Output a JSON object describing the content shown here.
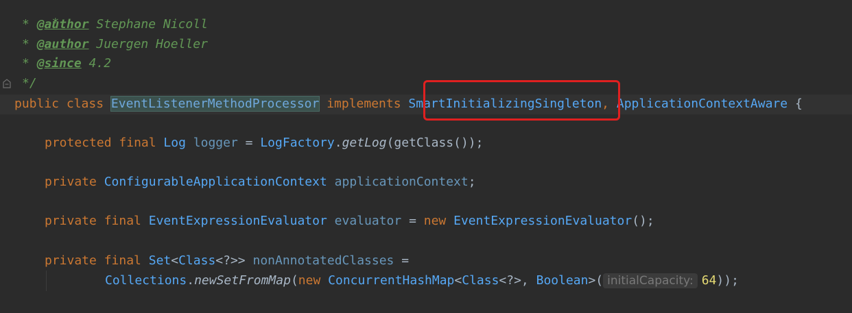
{
  "code": {
    "doc_lines": {
      "star": "*",
      "author1_tag": "@author",
      "author1_name": " Stephane Nicoll",
      "author2_tag": "@author",
      "author2_name": " Juergen Hoeller",
      "since_tag": "@since",
      "since_value": " 4.2",
      "close": "*/"
    },
    "class_decl": {
      "public": "public",
      "class": "class",
      "name": "EventListenerMethodProcessor",
      "implements": "implements",
      "iface1": "SmartInitializingSingleton",
      "comma": ",",
      "iface2": "ApplicationContextAware",
      "brace": "{"
    },
    "logger_line": {
      "protected": "protected",
      "final": "final",
      "type": "Log",
      "field": "logger",
      "eq": "=",
      "factory": "LogFactory",
      "dot": ".",
      "method": "getLog",
      "args": "(getClass());"
    },
    "context_line": {
      "private": "private",
      "type": "ConfigurableApplicationContext",
      "field": "applicationContext",
      "end": ";"
    },
    "evaluator_line": {
      "private": "private",
      "final": "final",
      "type": "EventExpressionEvaluator",
      "field": "evaluator",
      "eq": "=",
      "new": "new",
      "ctor": "EventExpressionEvaluator",
      "end": "();"
    },
    "classes_line": {
      "private": "private",
      "final": "final",
      "type_set": "Set",
      "type_rest1": "<",
      "type_class": "Class",
      "type_rest2": "<?>>",
      "field": "nonAnnotatedClasses",
      "eq": "="
    },
    "classes_line2": {
      "collections": "Collections",
      "dot": ".",
      "method": "newSetFromMap",
      "open": "(",
      "new": "new",
      "chm": "ConcurrentHashMap",
      "lt": "<",
      "class": "Class",
      "mid": "<?>, ",
      "boolean": "Boolean",
      "gt": ">(",
      "hint": "initialCapacity:",
      "num": "64",
      "end": "));"
    }
  }
}
